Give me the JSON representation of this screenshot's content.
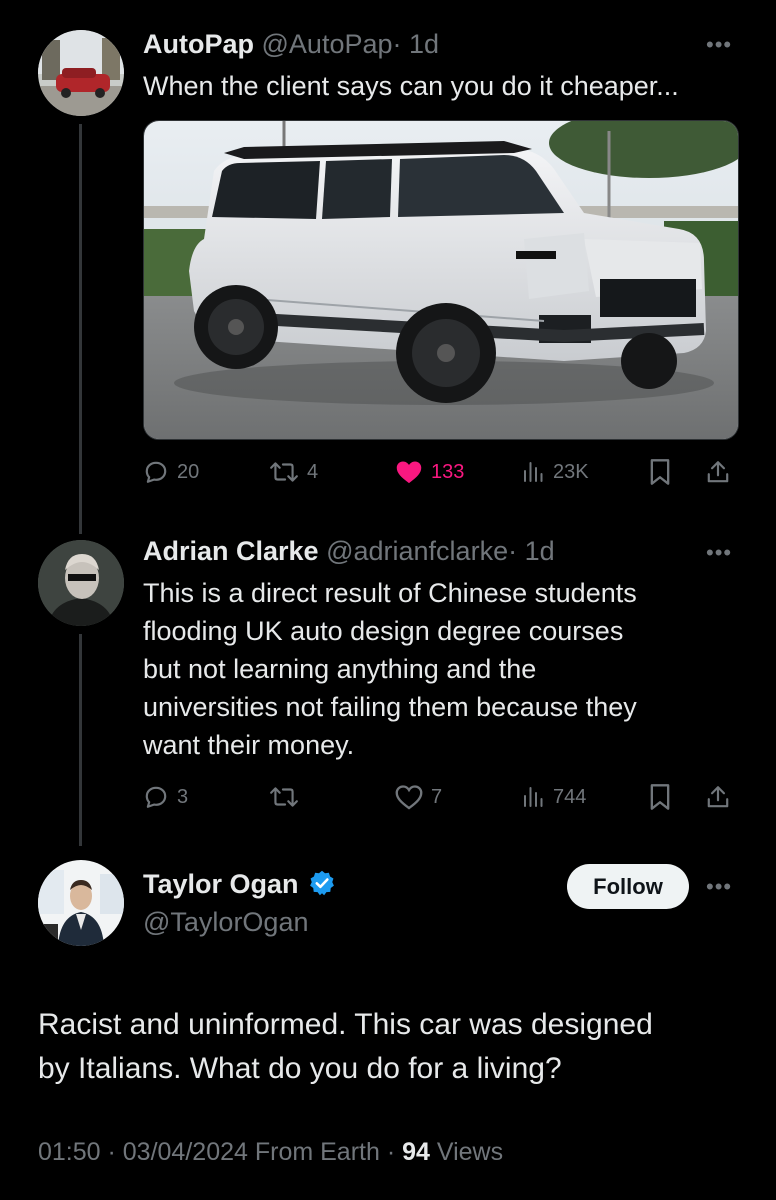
{
  "tweet1": {
    "name": "AutoPap",
    "handle": "@AutoPap",
    "time": "· 1d",
    "text": "When the client says can you do it cheaper...",
    "media_alt": "white SUV photo",
    "replies": "20",
    "retweets": "4",
    "likes": "133",
    "views": "23K",
    "like_color": "#f91880",
    "liked": true
  },
  "tweet2": {
    "name": "Adrian Clarke",
    "handle": "@adrianfclarke",
    "time": "· 1d",
    "text_lines": [
      "This is a direct result of Chinese students",
      "flooding UK auto design degree courses",
      "but not learning anything and the",
      "universities not failing them because they",
      "want their money."
    ],
    "replies": "3",
    "retweets": "",
    "likes": "7",
    "views": "744"
  },
  "tweet3": {
    "name": "Taylor Ogan",
    "handle": "@TaylorOgan",
    "verified": true,
    "verified_color": "#1d9bf0",
    "follow_label": "Follow",
    "text_lines": [
      "Racist and uninformed. This car was designed",
      "by Italians. What do you do for a living?"
    ],
    "meta_prefix": "01:50 · 03/04/2024 From Earth · ",
    "views_count": "94",
    "views_label": " Views"
  },
  "icons": {
    "reply": "reply-icon",
    "retweet": "retweet-icon",
    "like": "heart-icon",
    "views": "views-icon",
    "bookmark": "bookmark-icon",
    "share": "share-icon",
    "more": "more-icon",
    "verified": "verified-badge-icon"
  },
  "more_glyph": "•••"
}
